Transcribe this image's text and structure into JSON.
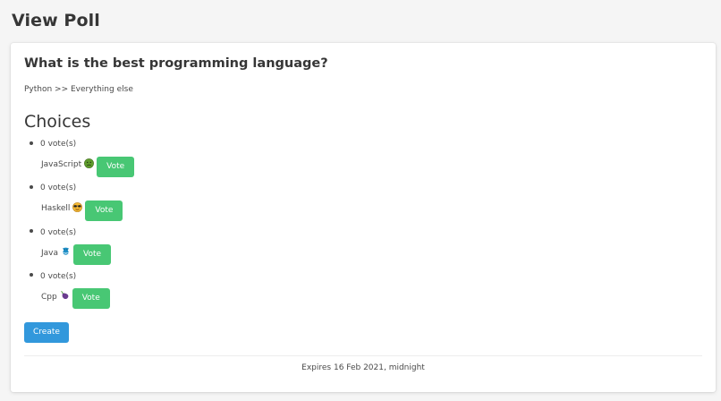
{
  "page": {
    "title": "View Poll"
  },
  "poll": {
    "question": "What is the best programming language?",
    "description": "Python >> Everything else",
    "choices_heading": "Choices",
    "choices": [
      {
        "label": "JavaScript",
        "votes_text": "0 vote(s)",
        "emoji": "nauseated-face-icon",
        "vote_label": "Vote"
      },
      {
        "label": "Haskell",
        "votes_text": "0 vote(s)",
        "emoji": "sunglasses-face-icon",
        "vote_label": "Vote"
      },
      {
        "label": "Java",
        "votes_text": "0 vote(s)",
        "emoji": "coffee-bean-icon",
        "vote_label": "Vote"
      },
      {
        "label": "Cpp",
        "votes_text": "0 vote(s)",
        "emoji": "eggplant-icon",
        "vote_label": "Vote"
      }
    ],
    "create_label": "Create",
    "expires_text": "Expires 16 Feb 2021, midnight"
  },
  "colors": {
    "vote_button": "#48c774",
    "create_button": "#3298dc",
    "background": "#f5f5f5",
    "card": "#ffffff"
  }
}
